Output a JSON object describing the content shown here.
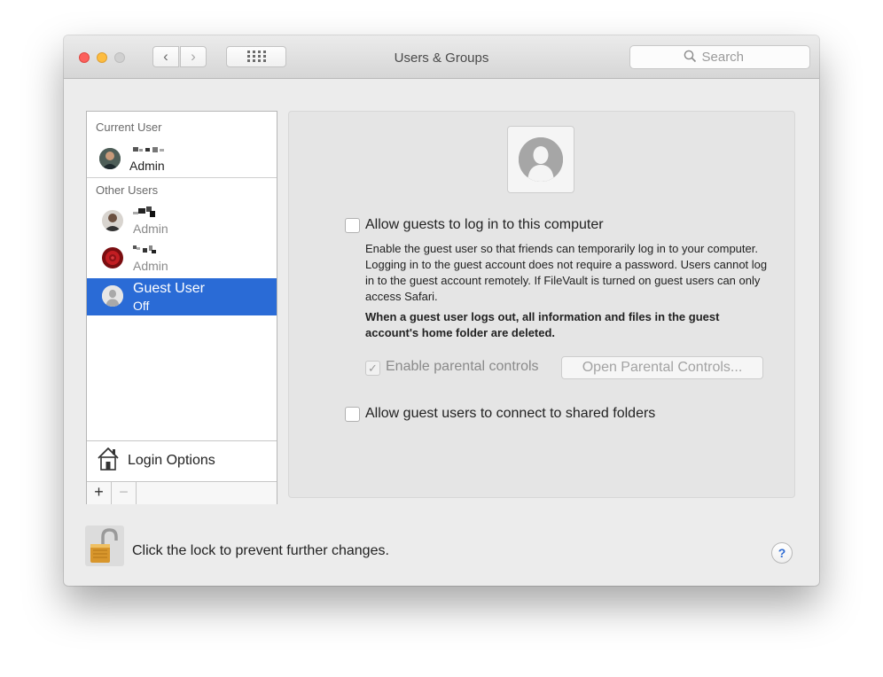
{
  "window": {
    "title": "Users & Groups",
    "nav": {
      "back": "‹",
      "forward": "›",
      "grid": "⋮⋮⋮"
    },
    "search": {
      "placeholder": "Search"
    }
  },
  "sidebar": {
    "current_user_header": "Current User",
    "current_user": {
      "role": "Admin"
    },
    "other_users_header": "Other Users",
    "other_users": [
      {
        "role": "Admin"
      },
      {
        "role": "Admin"
      }
    ],
    "guest": {
      "name": "Guest User",
      "status": "Off"
    },
    "login_options": "Login Options",
    "add": "+",
    "remove": "−"
  },
  "panel": {
    "allow_guests_label": "Allow guests to log in to this computer",
    "description": "Enable the guest user so that friends can temporarily log in to your computer. Logging in to the guest account does not require a password. Users cannot log in to the guest account remotely. If FileVault is turned on guest users can only access Safari.",
    "warning": "When a guest user logs out, all information and files in the guest account's home folder are deleted.",
    "parental_controls_label": "Enable parental controls",
    "parental_controls_check": "✓",
    "open_parental_controls": "Open Parental Controls...",
    "shared_folders_label": "Allow guest users to connect to shared folders"
  },
  "footer": {
    "lock_text": "Click the lock to prevent further changes.",
    "help": "?"
  }
}
